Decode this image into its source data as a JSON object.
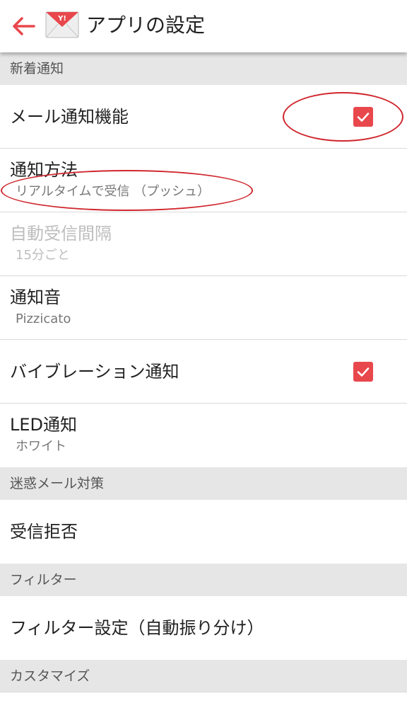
{
  "appbar": {
    "title": "アプリの設定",
    "back_icon": "arrow-left-icon",
    "logo_icon": "yahoo-mail-envelope-icon",
    "logo_text": "Y!",
    "accent_color": "#e8474c"
  },
  "sections": {
    "new_mail": "新着通知",
    "spam": "迷惑メール対策",
    "filter": "フィルター",
    "customize": "カスタマイズ"
  },
  "rows": {
    "mail_notification": {
      "title": "メール通知機能",
      "checked": true
    },
    "notification_method": {
      "title": "通知方法",
      "value": "リアルタイムで受信 （プッシュ）"
    },
    "auto_receive_interval": {
      "title": "自動受信間隔",
      "value": "15分ごと",
      "enabled": false
    },
    "notification_sound": {
      "title": "通知音",
      "value": "Pizzicato"
    },
    "vibration": {
      "title": "バイブレーション通知",
      "checked": true
    },
    "led": {
      "title": "LED通知",
      "value": "ホワイト"
    },
    "block_senders": {
      "title": "受信拒否"
    },
    "filter_settings": {
      "title": "フィルター設定（自動振り分け）"
    }
  },
  "annotations": {
    "color": "#d0262d"
  }
}
